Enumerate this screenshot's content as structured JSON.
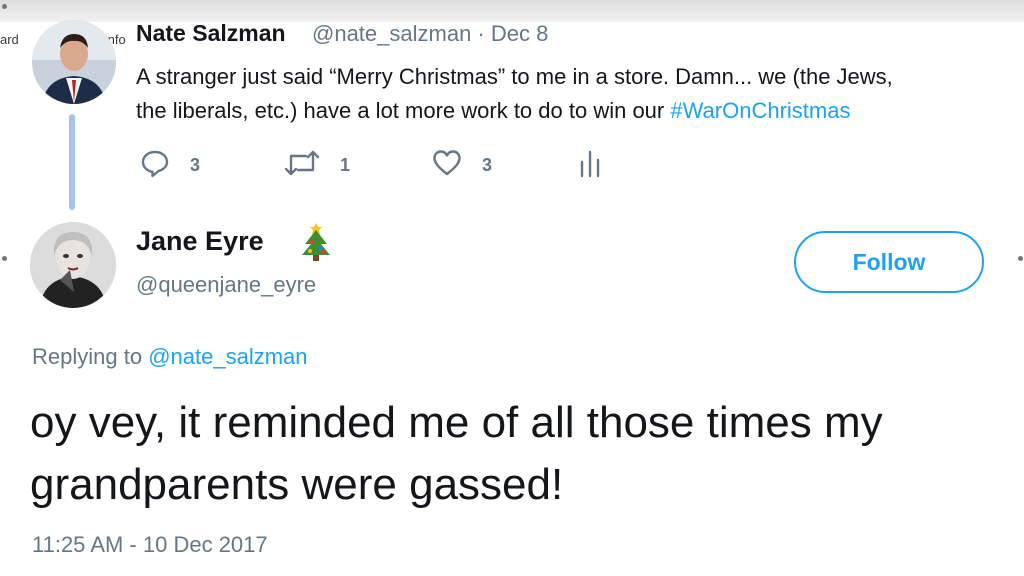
{
  "app_frame": {
    "left_label": "ard",
    "info_label": "Info"
  },
  "parent_tweet": {
    "author_name": "Nate Salzman",
    "author_handle": "@nate_salzman",
    "date_separator": "·",
    "date": "Dec 8",
    "text_line1": "A stranger just said “Merry Christmas” to me in a store. Damn... we (the Jews,",
    "text_line2_plain": "the liberals, etc.) have a lot more work to do to win our ",
    "hashtag": "#WarOnChristmas",
    "reply_count": "3",
    "retweet_count": "1",
    "like_count": "3"
  },
  "reply_tweet": {
    "author_name": "Jane Eyre",
    "author_handle": "@queenjane_eyre",
    "follow_label": "Follow",
    "replying_to_label": "Replying to",
    "replying_to_handle": "@nate_salzman",
    "text": "oy vey, it reminded me of all those times my grandparents were gassed!",
    "timestamp": "11:25 AM - 10 Dec 2017"
  },
  "colors": {
    "link_blue": "#1da1f2",
    "muted_gray": "#657786",
    "text_dark": "#14171a",
    "thread_line": "#a9c3f0"
  },
  "icons": [
    "info-icon",
    "reply-icon",
    "retweet-icon",
    "like-icon",
    "analytics-icon",
    "christmas-tree-emoji"
  ]
}
